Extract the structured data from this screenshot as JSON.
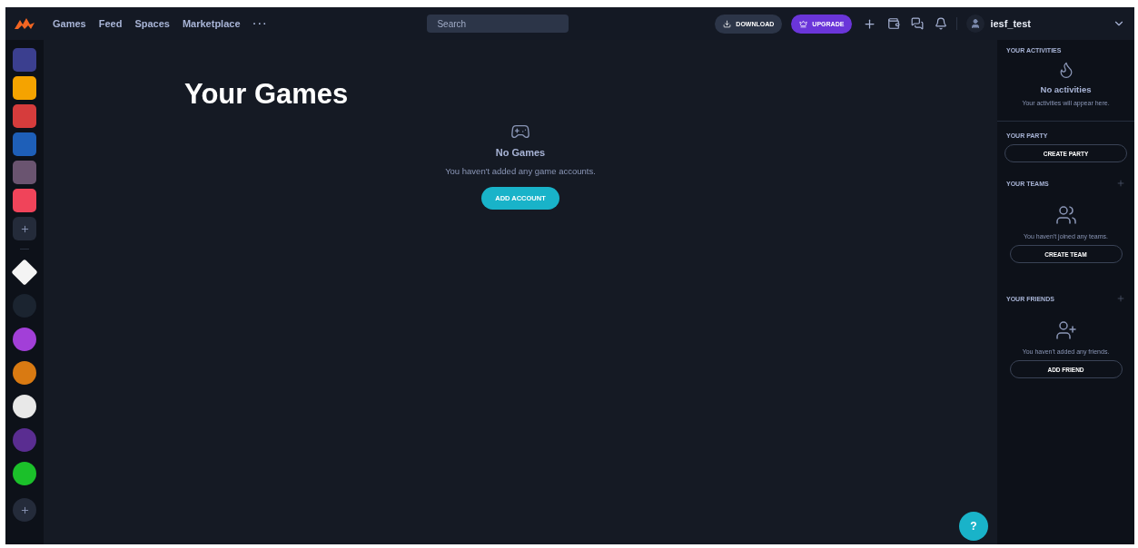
{
  "nav": {
    "links": [
      "Games",
      "Feed",
      "Spaces",
      "Marketplace"
    ],
    "more": "···"
  },
  "search": {
    "placeholder": "Search"
  },
  "actions": {
    "download": "DOWNLOAD",
    "upgrade": "UPGRADE"
  },
  "user": {
    "name": "iesf_test"
  },
  "games": [
    {
      "kind": "square",
      "color": "#3b3f8f"
    },
    {
      "kind": "square",
      "color": "#f5a300"
    },
    {
      "kind": "square",
      "color": "#d63c3c"
    },
    {
      "kind": "square",
      "color": "#1e5fb8"
    },
    {
      "kind": "square",
      "color": "#6a5470"
    },
    {
      "kind": "square",
      "color": "#f0445a"
    }
  ],
  "spaces": [
    {
      "kind": "diamond",
      "color": "#f4f4f4"
    },
    {
      "kind": "circle",
      "color": "#1b2430"
    },
    {
      "kind": "circle",
      "color": "#a23fd8"
    },
    {
      "kind": "circle",
      "color": "#d97a12"
    },
    {
      "kind": "circle",
      "color": "#e8e8e8"
    },
    {
      "kind": "circle",
      "color": "#5a2d91"
    },
    {
      "kind": "circle",
      "color": "#1bc02a"
    }
  ],
  "main": {
    "title": "Your Games",
    "empty_title": "No Games",
    "empty_text": "You haven't added any game accounts.",
    "button": "ADD ACCOUNT"
  },
  "help": "?",
  "sidebar": {
    "activities": {
      "heading": "YOUR ACTIVITIES",
      "title": "No activities",
      "text": "Your activities will appear here."
    },
    "party": {
      "heading": "YOUR PARTY",
      "button": "CREATE PARTY"
    },
    "teams": {
      "heading": "YOUR TEAMS",
      "text": "You haven't joined any teams.",
      "button": "CREATE TEAM"
    },
    "friends": {
      "heading": "YOUR FRIENDS",
      "text": "You haven't added any friends.",
      "button": "ADD FRIEND"
    }
  }
}
